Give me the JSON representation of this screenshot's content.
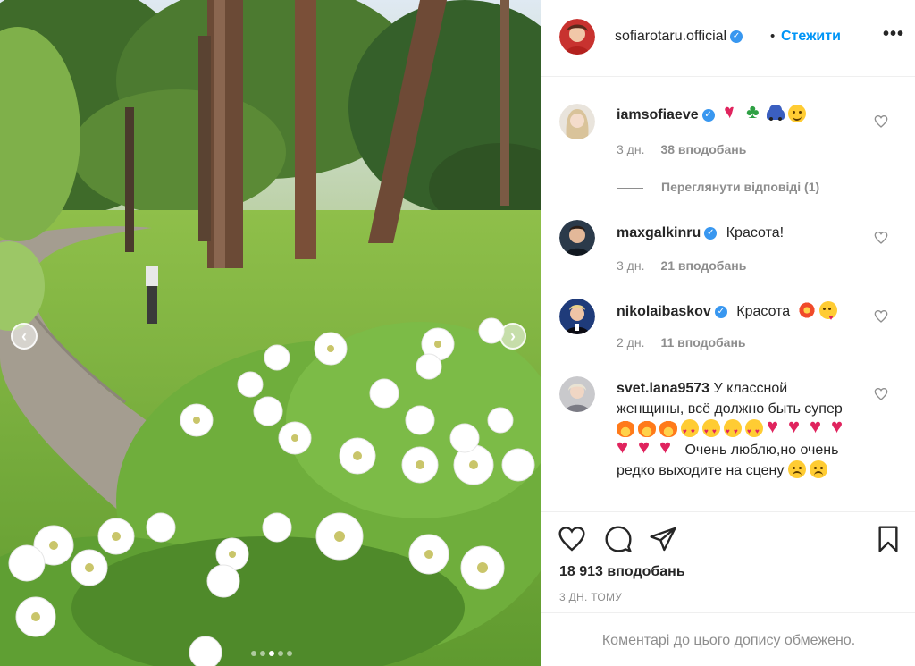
{
  "post": {
    "author": "sofiarotaru.official",
    "separator": "•",
    "follow_label": "Стежити",
    "more_label": "•••",
    "likes_total": "18 913 вподобань",
    "date": "3 ДН. ТОМУ",
    "comments_closed": "Коментарі до цього допису обмежено.",
    "carousel": {
      "slide_count": 5,
      "current_slide": 2
    }
  },
  "comments": [
    {
      "user": "iamsofiaeve",
      "verified": true,
      "text": "",
      "emojis": [
        "broken-heart-emoji",
        "clover-emoji",
        "car-emoji",
        "smiling-hearts-emoji"
      ],
      "age": "3 дн.",
      "likes": "38 вподобань",
      "replies": "Переглянути відповіді (1)"
    },
    {
      "user": "maxgalkinru",
      "verified": true,
      "text": "Красота!",
      "age": "3 дн.",
      "likes": "21 вподобань"
    },
    {
      "user": "nikolaibaskov",
      "verified": true,
      "text": "Красота",
      "emojis": [
        "collision-emoji",
        "kiss-emoji"
      ],
      "age": "2 дн.",
      "likes": "11 вподобань"
    },
    {
      "user": "svet.lana9573",
      "verified": false,
      "text_part1": "У классной женщины, всё должно быть супер",
      "text_part2": "Очень люблю,но очень редко выходите на сцену"
    }
  ],
  "colors": {
    "link_blue": "#0095f6",
    "verified_blue": "#3897f0",
    "muted_gray": "#8e8e8e",
    "text_dark": "#262626",
    "divider": "#efefef"
  }
}
